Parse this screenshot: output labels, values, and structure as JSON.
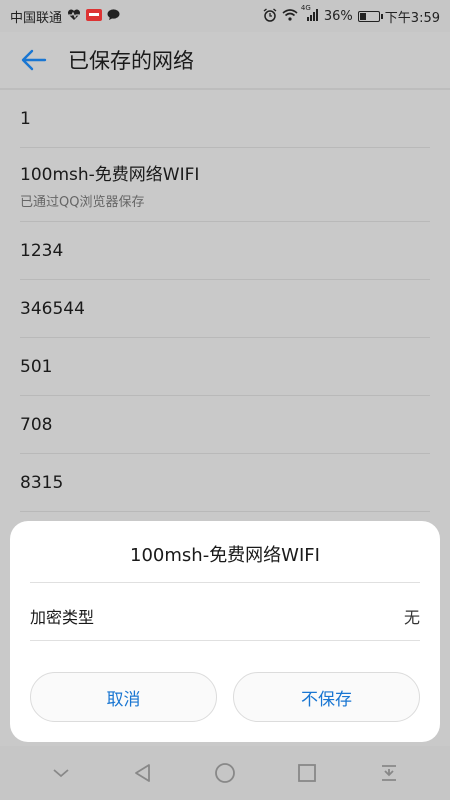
{
  "status_bar": {
    "carrier": "中国联通",
    "network_type": "4G",
    "battery_text": "36%",
    "battery_level": 0.36,
    "time": "下午3:59"
  },
  "header": {
    "title": "已保存的网络"
  },
  "networks": [
    {
      "name": "1"
    },
    {
      "name": "100msh-免费网络WIFI",
      "sub": "已通过QQ浏览器保存"
    },
    {
      "name": "1234"
    },
    {
      "name": "346544"
    },
    {
      "name": "501"
    },
    {
      "name": "708"
    },
    {
      "name": "8315"
    }
  ],
  "dialog": {
    "title": "100msh-免费网络WIFI",
    "field_label": "加密类型",
    "field_value": "无",
    "cancel_label": "取消",
    "forget_label": "不保存"
  },
  "colors": {
    "accent": "#1976d2"
  }
}
